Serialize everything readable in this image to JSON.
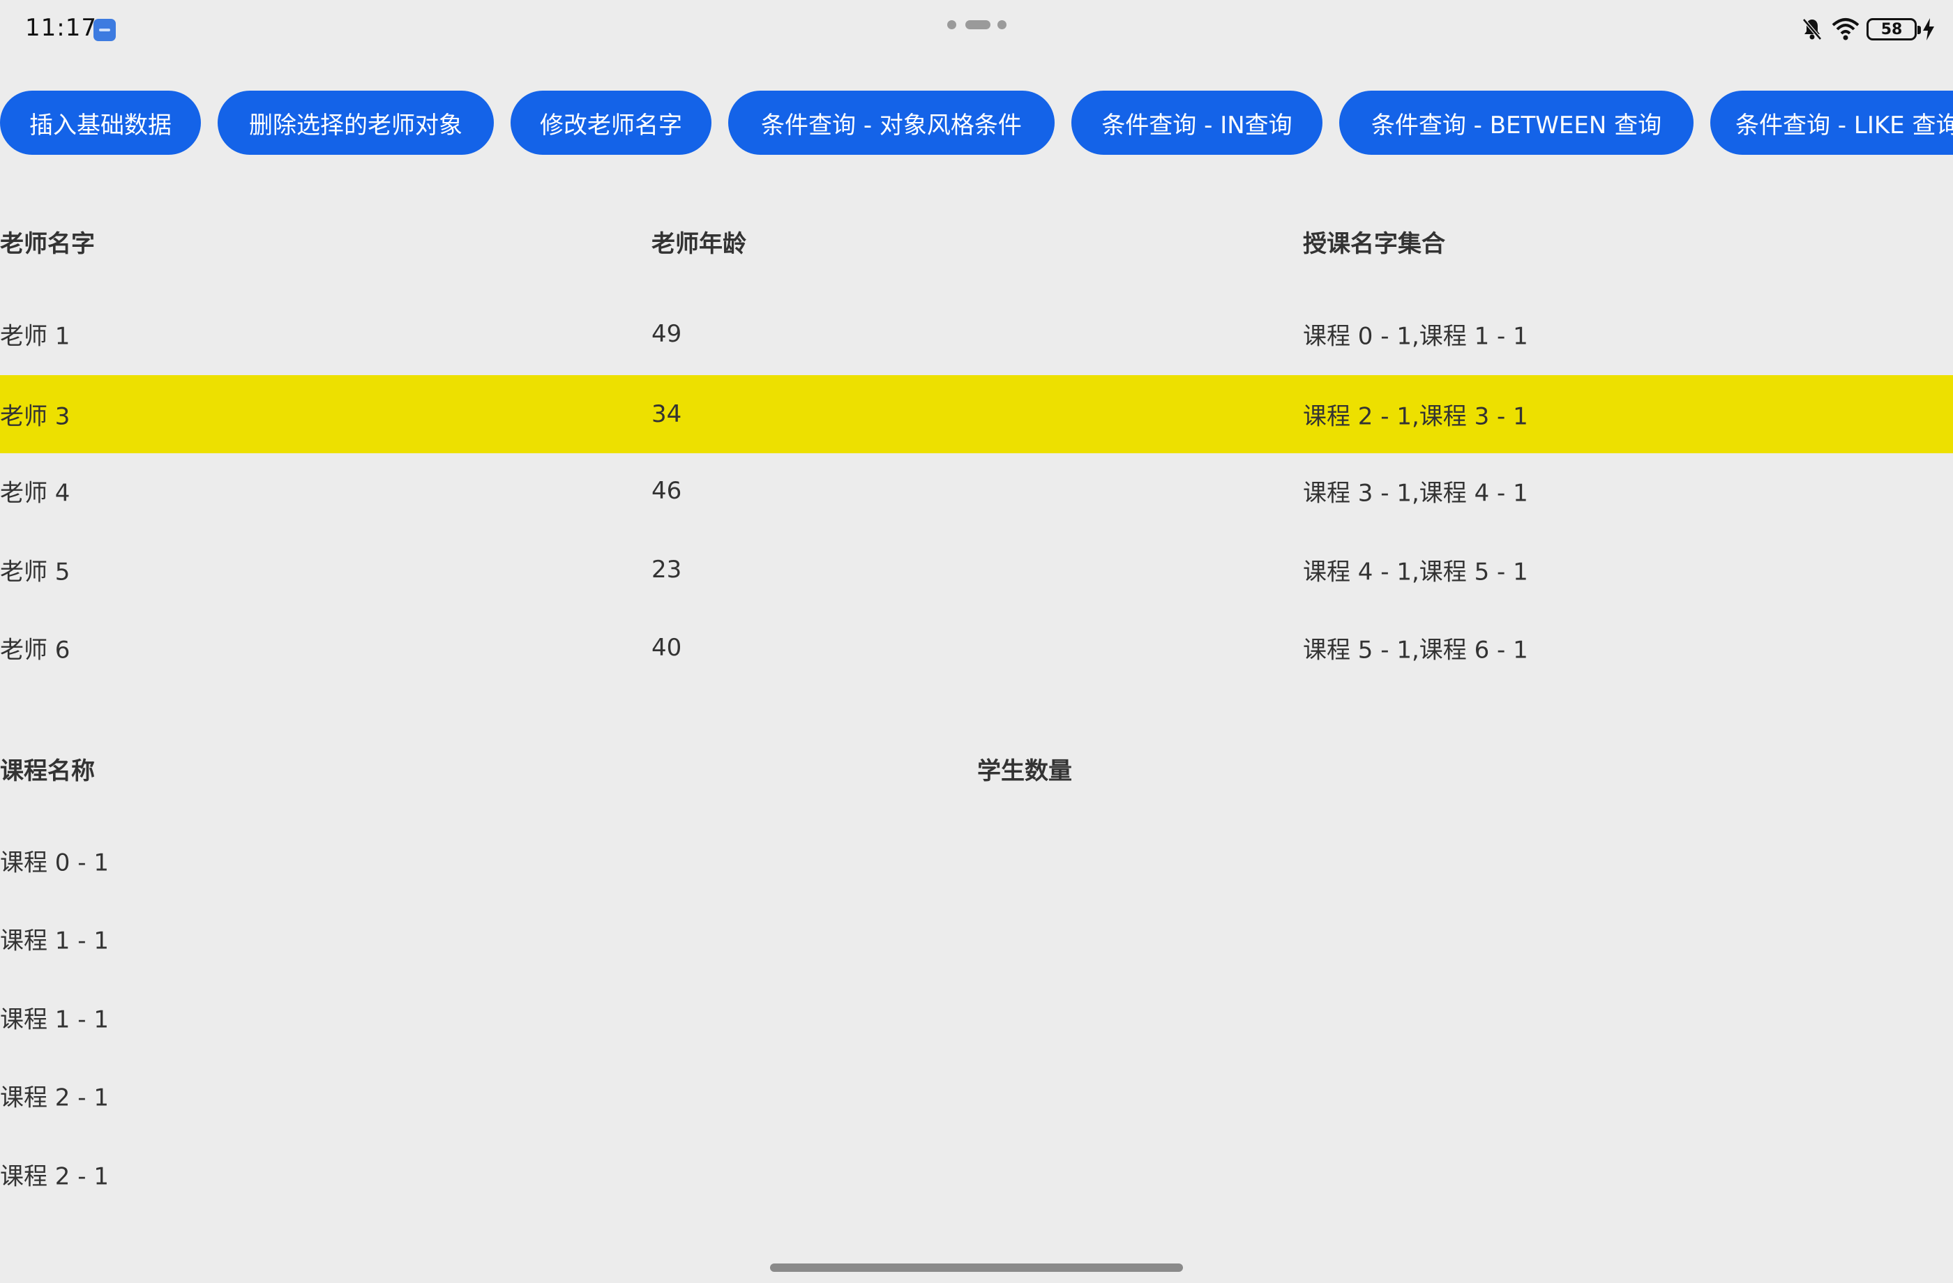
{
  "status_bar": {
    "time": "11:17",
    "battery": "58",
    "icons": [
      "usb-debug-icon",
      "bell-off-icon",
      "wifi-icon",
      "battery-icon",
      "charging-icon"
    ]
  },
  "buttons": [
    "插入基础数据",
    "删除选择的老师对象",
    "修改老师名字",
    "条件查询 - 对象风格条件",
    "条件查询 - IN查询",
    "条件查询 - BETWEEN 查询",
    "条件查询 - LIKE 查询"
  ],
  "teachers_table": {
    "headers": [
      "老师名字",
      "老师年龄",
      "授课名字集合"
    ],
    "rows": [
      [
        "老师 1",
        "49",
        "课程 0 - 1,课程 1 - 1"
      ],
      [
        "老师 3",
        "34",
        "课程 2 - 1,课程 3 - 1"
      ],
      [
        "老师 4",
        "46",
        "课程 3 - 1,课程 4 - 1"
      ],
      [
        "老师 5",
        "23",
        "课程 4 - 1,课程 5 - 1"
      ],
      [
        "老师 6",
        "40",
        "课程 5 - 1,课程 6 - 1"
      ]
    ],
    "selected_row": 1,
    "highlight_color": "#ede000"
  },
  "courses_table": {
    "headers": [
      "课程名称",
      "学生数量"
    ],
    "rows": [
      [
        "课程 0 - 1",
        ""
      ],
      [
        "课程 1 - 1",
        ""
      ],
      [
        "课程 1 - 1",
        ""
      ],
      [
        "课程 2 - 1",
        ""
      ],
      [
        "课程 2 - 1",
        ""
      ]
    ]
  },
  "colors": {
    "background": "#ececec",
    "button": "#1463e8",
    "button_text": "#ffffff"
  }
}
